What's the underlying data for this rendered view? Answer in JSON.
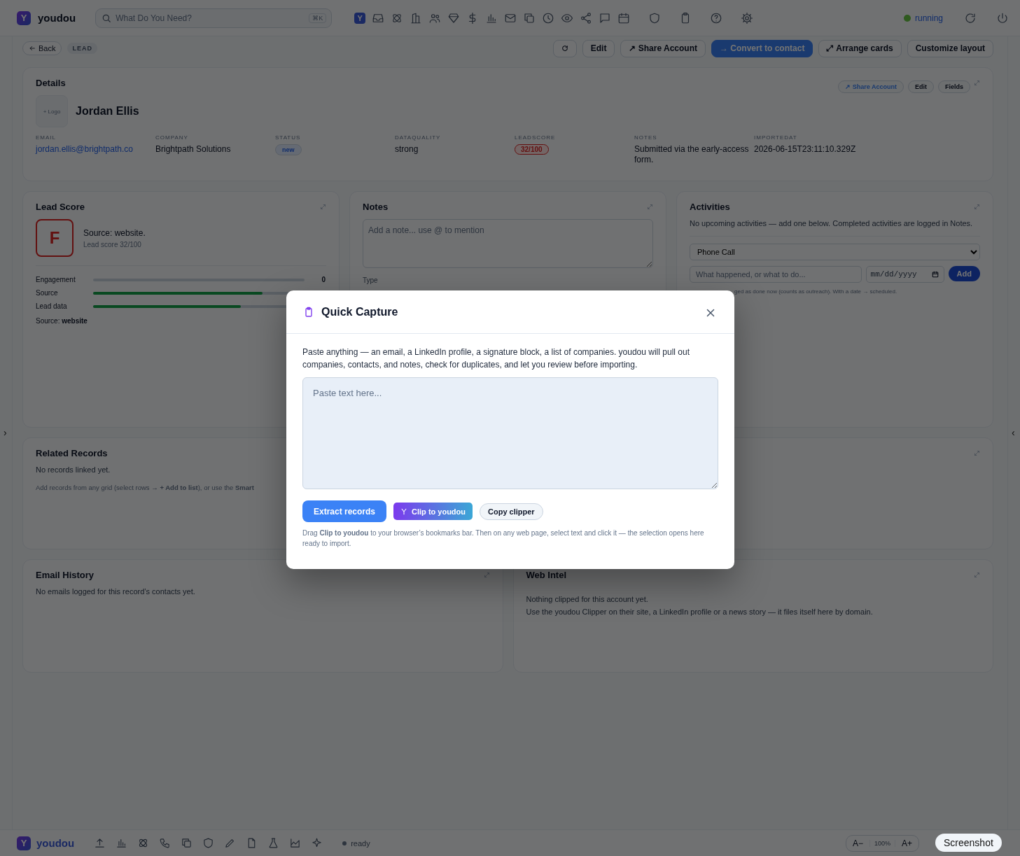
{
  "topbar": {
    "logo_mark": "Y",
    "app_name": "youdou",
    "search": {
      "placeholder": "What Do You Need?",
      "shortcut": "⌘K"
    },
    "nav_mark": "Y",
    "status": {
      "label": "running",
      "color": "#2f5a1f"
    }
  },
  "toolbar": {
    "back": "Back",
    "record_type": "LEAD",
    "buttons": [
      {
        "kind": "icon"
      },
      {
        "kind": "plain",
        "label": "Edit"
      },
      {
        "kind": "plain",
        "label": "↗ Share Account"
      },
      {
        "kind": "primary",
        "label": "→ Convert to contact"
      },
      {
        "kind": "plain",
        "label": "⤢ Arrange cards"
      },
      {
        "kind": "plain",
        "label": "Customize layout"
      }
    ]
  },
  "details": {
    "title": "Details",
    "actions": [
      {
        "kind": "link",
        "label": "↗ Share Account"
      },
      {
        "kind": "plain",
        "label": "Edit"
      },
      {
        "kind": "plain",
        "label": "Fields"
      }
    ],
    "logo_placeholder": "+ Logo",
    "name": "Jordan Ellis",
    "fields": [
      {
        "label": "EMAIL",
        "value": "jordan.ellis@brightpath.co",
        "kind": "link"
      },
      {
        "label": "COMPANY",
        "value": "Brightpath Solutions",
        "kind": "text"
      },
      {
        "label": "STATUS",
        "value": "new",
        "kind": "badge"
      },
      {
        "label": "DATAQUALITY",
        "value": "strong",
        "kind": "text"
      },
      {
        "label": "LEADSCORE",
        "value": "32/100",
        "kind": "score"
      },
      {
        "label": "NOTES",
        "value": "Submitted via the early-access form.",
        "kind": "text"
      },
      {
        "label": "IMPORTEDAT",
        "value": "2026-06-15T23:11:10.329Z",
        "kind": "text"
      }
    ]
  },
  "lead_score": {
    "title": "Lead Score",
    "grade": "F",
    "summary": "Source: website.",
    "score_text": "Lead score 32/100",
    "bars": [
      {
        "label": "Engagement",
        "level": 0,
        "value": "0"
      },
      {
        "label": "Source",
        "level": 0.8
      },
      {
        "label": "Lead data",
        "level": 0.7
      }
    ],
    "footer": "Source: **website**"
  },
  "notes": {
    "title": "Notes",
    "placeholder": "Add a note... use @ to mention",
    "type_label": "Type"
  },
  "activities": {
    "title": "Activities",
    "intro": "No upcoming activities — add one below. Completed activities are logged in Notes.",
    "type_value": "Phone Call",
    "what_placeholder": "What happened, or what to do...",
    "date_placeholder": "mm/dd/yyyy",
    "add_button": "Add",
    "hint": "ged as done now (counts as outreach). With a date → scheduled."
  },
  "related_records": {
    "title": "Related Records",
    "empty": "No records linked yet.",
    "hint": "Add records from any grid (select rows → **+ Add to list**), or use the **Smart**"
  },
  "email_history": {
    "title": "Email History",
    "empty": "No emails logged for this record’s contacts yet."
  },
  "web_intel": {
    "title": "Web Intel",
    "lines": [
      "Nothing clipped for this account yet.",
      "Use the youdou Clipper on their site, a LinkedIn profile or a news story — it files itself here by domain."
    ]
  },
  "modal": {
    "title": "Quick Capture",
    "description": "Paste anything — an email, a LinkedIn profile, a signature block, a list of companies. youdou will pull out companies, contacts, and notes, check for duplicates, and let you review before importing.",
    "placeholder": "Paste text here...",
    "buttons": [
      {
        "kind": "primary",
        "label": "Extract records"
      },
      {
        "kind": "gradient",
        "label": "Clip to youdou"
      },
      {
        "kind": "secondary",
        "label": "Copy clipper"
      }
    ],
    "hint": "Drag **Clip to youdou** to your browser’s bookmarks bar. Then on any web page, select text and click it — the selection opens here ready to import."
  },
  "bottombar": {
    "logo_mark": "Y",
    "app_name": "youdou",
    "status": "ready",
    "zoom_out": "A−",
    "zoom_level": "100%",
    "zoom_in": "A+"
  },
  "side_toggles": {
    "left": "›",
    "right": "‹"
  },
  "tooltip": "Screenshot"
}
